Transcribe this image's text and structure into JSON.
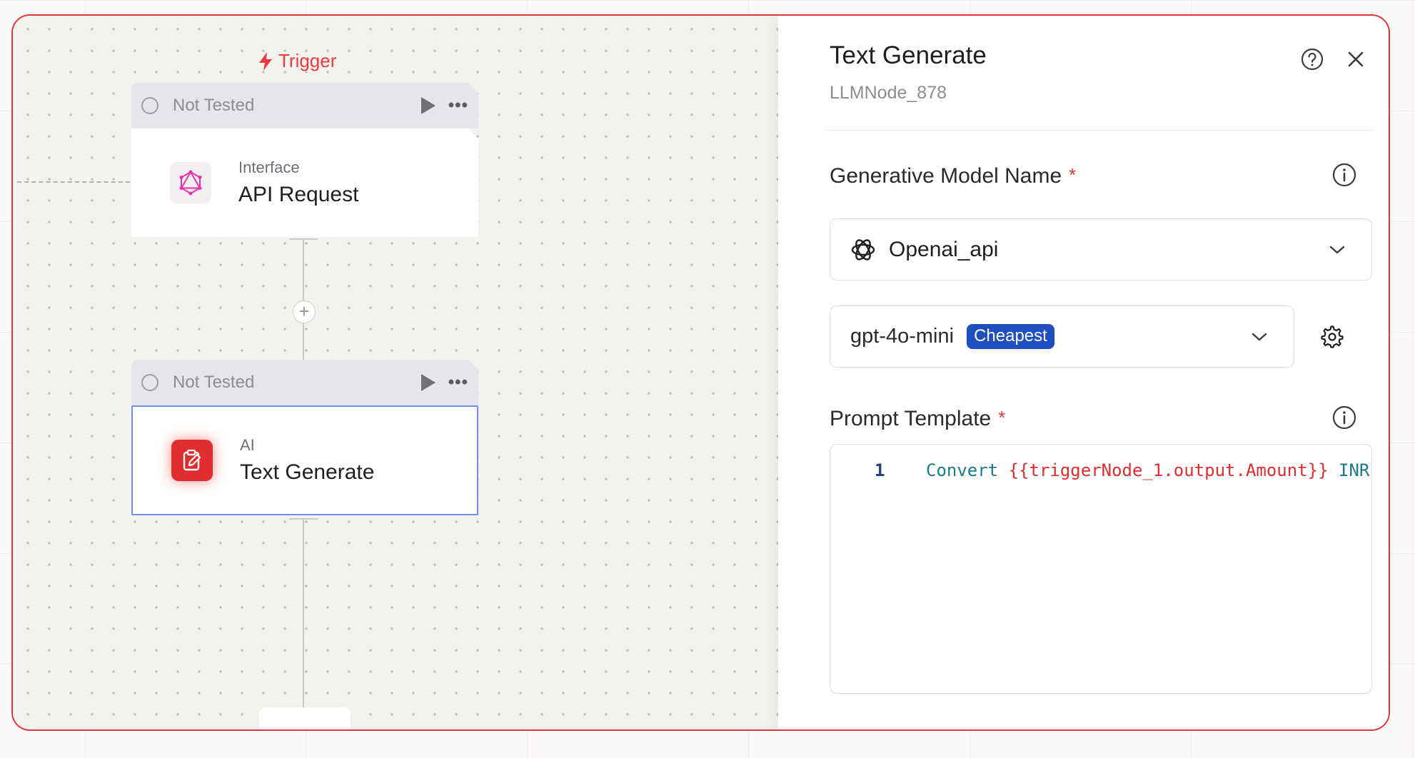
{
  "canvas": {
    "trigger_label": "Trigger",
    "nodes": [
      {
        "status": "Not Tested",
        "category": "Interface",
        "name": "API Request",
        "icon": "graphql-icon"
      },
      {
        "status": "Not Tested",
        "category": "AI",
        "name": "Text Generate",
        "icon": "ai-edit-icon",
        "selected": true
      }
    ],
    "add_step_label": "+"
  },
  "panel": {
    "title": "Text Generate",
    "subtitle": "LLMNode_878",
    "model_field": {
      "label": "Generative Model Name",
      "required_mark": "*",
      "value": "Openai_api",
      "icon": "openai-icon"
    },
    "variant_field": {
      "value": "gpt-4o-mini",
      "badge": "Cheapest"
    },
    "prompt_field": {
      "label": "Prompt Template",
      "required_mark": "*",
      "line_number": "1",
      "code_keyword": "Convert",
      "code_variable": "{{triggerNode_1.output.Amount}}",
      "code_rest": "INR"
    }
  },
  "colors": {
    "accent_red": "#e4343a",
    "badge_blue": "#1f4fbf",
    "selection_blue": "#6f8fe6"
  }
}
